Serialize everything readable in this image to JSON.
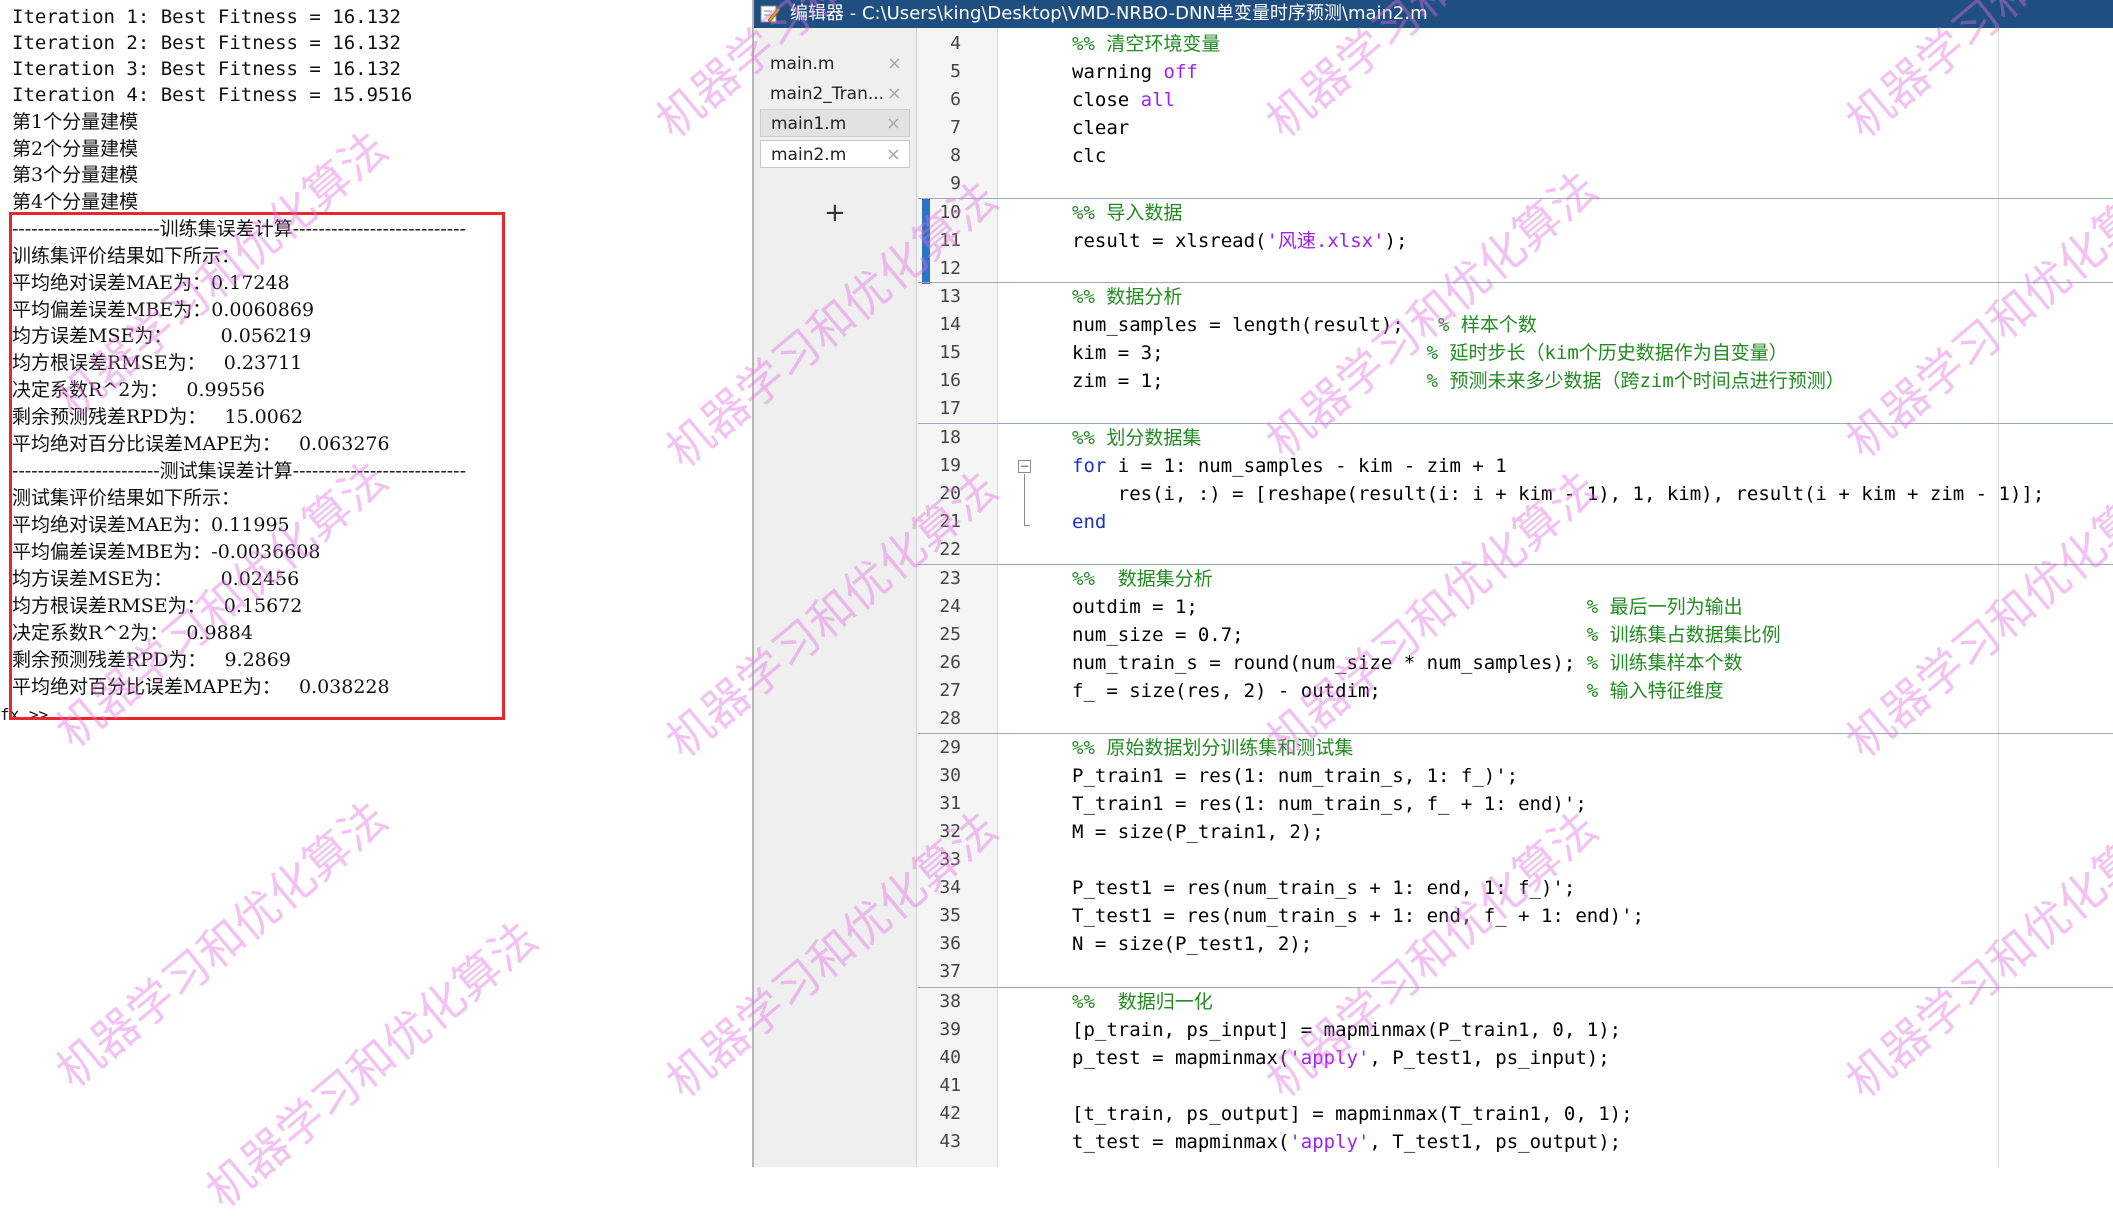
{
  "command_window": {
    "lines": [
      "Iteration 1: Best Fitness = 16.132",
      "Iteration 2: Best Fitness = 16.132",
      "Iteration 3: Best Fitness = 16.132",
      "Iteration 4: Best Fitness = 15.9516",
      "第1个分量建模",
      "第2个分量建模",
      "第3个分量建模",
      "第4个分量建模",
      "-----------------------训练集误差计算---------------------------",
      "训练集评价结果如下所示：",
      "平均绝对误差MAE为：0.17248",
      "平均偏差误差MBE为：0.0060869",
      "均方误差MSE为：        0.056219",
      "均方根误差RMSE为：   0.23711",
      "决定系数R^2为：   0.99556",
      "剩余预测残差RPD为：   15.0062",
      "平均绝对百分比误差MAPE为：   0.063276",
      "-----------------------测试集误差计算---------------------------",
      "测试集评价结果如下所示：",
      "平均绝对误差MAE为：0.11995",
      "平均偏差误差MBE为：-0.0036608",
      "均方误差MSE为：        0.02456",
      "均方根误差RMSE为：   0.15672",
      "决定系数R^2为：   0.9884",
      "剩余预测残差RPD为：   9.2869",
      "平均绝对百分比误差MAPE为：   0.038228",
      "fx >>"
    ]
  },
  "editor": {
    "title": "编辑器 - C:\\Users\\king\\Desktop\\VMD-NRBO-DNN单变量时序预测\\main2.m",
    "tabs": [
      {
        "label": "main.m",
        "close": "×"
      },
      {
        "label": "main2_Tran...",
        "close": "×"
      },
      {
        "label": "main1.m",
        "close": "×"
      },
      {
        "label": "main2.m",
        "close": "×"
      }
    ],
    "add_tab": "+",
    "line_numbers": [
      "4",
      "5",
      "6",
      "7",
      "8",
      "9",
      "10",
      "11",
      "12",
      "13",
      "14",
      "15",
      "16",
      "17",
      "18",
      "19",
      "20",
      "21",
      "22",
      "23",
      "24",
      "25",
      "26",
      "27",
      "28",
      "29",
      "30",
      "31",
      "32",
      "33",
      "34",
      "35",
      "36",
      "37",
      "38",
      "39",
      "40",
      "41",
      "42",
      "43"
    ],
    "code": {
      "l4": "%% 清空环境变量",
      "l5a": "warning ",
      "l5b": "off",
      "l6a": "close ",
      "l6b": "all",
      "l7": "clear",
      "l8": "clc",
      "l10": "%% 导入数据",
      "l11a": "result = xlsread(",
      "l11b": "'风速.xlsx'",
      "l11c": ");",
      "l13": "%% 数据分析",
      "l14a": "num_samples = length(result);   ",
      "l14b": "% 样本个数",
      "l15a": "kim = 3;                       ",
      "l15b": "% 延时步长（kim个历史数据作为自变量）",
      "l16a": "zim = 1;                       ",
      "l16b": "% 预测未来多少数据（跨zim个时间点进行预测）",
      "l18": "%% 划分数据集",
      "l19a": "for",
      "l19b": " i = 1: num_samples - kim - zim + 1",
      "l20": "    res(i, :) = [reshape(result(i: i + kim - 1), 1, kim), result(i + kim + zim - 1)];",
      "l21": "end",
      "l23": "%%  数据集分析",
      "l24a": "outdim = 1;                                  ",
      "l24b": "% 最后一列为输出",
      "l25a": "num_size = 0.7;                              ",
      "l25b": "% 训练集占数据集比例",
      "l26a": "num_train_s = round(num_size * num_samples); ",
      "l26b": "% 训练集样本个数",
      "l27a": "f_ = size(res, 2) - outdim;                  ",
      "l27b": "% 输入特征维度",
      "l29": "%% 原始数据划分训练集和测试集",
      "l30": "P_train1 = res(1: num_train_s, 1: f_)';",
      "l31": "T_train1 = res(1: num_train_s, f_ + 1: end)';",
      "l32": "M = size(P_train1, 2);",
      "l34": "P_test1 = res(num_train_s + 1: end, 1: f_)';",
      "l35": "T_test1 = res(num_train_s + 1: end, f_ + 1: end)';",
      "l36": "N = size(P_test1, 2);",
      "l38": "%%  数据归一化",
      "l39": "[p_train, ps_input] = mapminmax(P_train1, 0, 1);",
      "l40a": "p_test = mapminmax(",
      "l40b": "'apply'",
      "l40c": ", P_test1, ps_input);",
      "l42": "[t_train, ps_output] = mapminmax(T_train1, 0, 1);",
      "l43a": "t_test = mapminmax(",
      "l43b": "'apply'",
      "l43c": ", T_test1, ps_output);"
    }
  },
  "watermark": "机器学习和优化算法",
  "colors": {
    "titlebar": "#1e4f80",
    "keyword": "#1b2fd6",
    "string": "#a020f0",
    "comment": "#228b22",
    "highlight_box": "#e8262b",
    "watermark": "#e16ee1"
  }
}
